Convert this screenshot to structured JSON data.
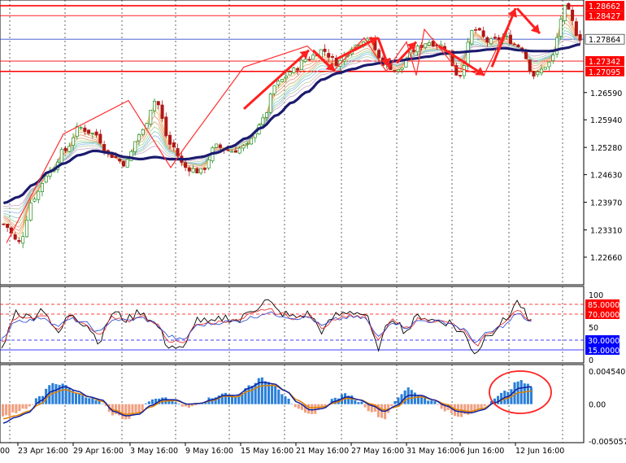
{
  "chart_data": [
    {
      "type": "candlestick",
      "title": "",
      "price_scale": {
        "ylim": [
          1.22,
          1.288
        ],
        "ticks": [
          "1.22660",
          "1.23310",
          "1.23970",
          "1.24630",
          "1.25280",
          "1.25940",
          "1.26590"
        ],
        "highlighted_levels": [
          {
            "label": "1.28662",
            "value": 1.28662,
            "color": "#ff0000"
          },
          {
            "label": "1.28427",
            "value": 1.28427,
            "color": "#ff0000"
          },
          {
            "label": "1.27864",
            "value": 1.27864,
            "color": "#3050c8",
            "current_price": true
          },
          {
            "label": "1.27342",
            "value": 1.27342,
            "color": "#ff0000"
          },
          {
            "label": "1.27095",
            "value": 1.27095,
            "color": "#ff0000"
          }
        ]
      },
      "x_axis_labels": [
        "23 Apr 16:00",
        "29 Apr 16:00",
        "3 May 16:00",
        "9 May 16:00",
        "15 May 16:00",
        "21 May 16:00",
        "27 May 16:00",
        "31 May 16:00",
        "6 Jun 16:00",
        "12 Jun 16:00"
      ],
      "series": [
        {
          "name": "",
          "kind": "price",
          "values": [
            1.2345,
            1.23,
            1.241,
            1.247,
            1.252,
            1.2575,
            1.256,
            1.251,
            1.249,
            1.256,
            1.264,
            1.2535,
            1.248,
            1.247,
            1.253,
            1.252,
            1.253,
            1.259,
            1.268,
            1.271,
            1.274,
            1.276,
            1.273,
            1.277,
            1.279,
            1.273,
            1.271,
            1.276,
            1.278,
            1.277,
            1.27,
            1.281,
            1.278,
            1.279,
            1.277,
            1.27,
            1.273,
            1.286,
            1.279
          ]
        },
        {
          "name": "",
          "kind": "slow-ma",
          "color": "#1b1b6e",
          "values": [
            1.2395,
            1.241,
            1.244,
            1.247,
            1.249,
            1.251,
            1.252,
            1.2515,
            1.2505,
            1.25,
            1.2505,
            1.25,
            1.25,
            1.2505,
            1.2515,
            1.253,
            1.255,
            1.2575,
            1.2605,
            1.2635,
            1.266,
            1.269,
            1.2705,
            1.2715,
            1.2725,
            1.273,
            1.2735,
            1.274,
            1.2745,
            1.2752,
            1.2755,
            1.2758,
            1.2762,
            1.2765,
            1.276,
            1.2758,
            1.2758,
            1.2765,
            1.2774
          ]
        }
      ],
      "pattern_lines": {
        "color": "#ff3030",
        "zigzag": [
          1.23,
          1.256,
          1.264,
          1.248,
          1.253,
          1.272,
          1.277,
          1.271,
          1.279,
          1.271,
          1.278,
          1.27,
          1.281,
          1.272,
          1.27,
          1.286
        ],
        "arrows": [
          {
            "from": 1.262,
            "to": 1.276
          },
          {
            "from": 1.276,
            "to": 1.271
          },
          {
            "from": 1.274,
            "to": 1.279
          },
          {
            "from": 1.279,
            "to": 1.272
          },
          {
            "from": 1.273,
            "to": 1.278
          },
          {
            "from": 1.277,
            "to": 1.27
          },
          {
            "from": 1.272,
            "to": 1.286
          },
          {
            "from": 1.286,
            "to": 1.28
          }
        ]
      }
    },
    {
      "type": "line",
      "title": "",
      "ylim": [
        0,
        100
      ],
      "y_ticks": [
        "100",
        "50",
        "0"
      ],
      "levels": [
        {
          "label": "85.0000",
          "value": 85,
          "color": "#ff0000"
        },
        {
          "label": "70.0000",
          "value": 70,
          "color": "#ff0000"
        },
        {
          "label": "30.0000",
          "value": 30,
          "color": "#0000ff"
        },
        {
          "label": "15.0000",
          "value": 15,
          "color": "#0000ff"
        }
      ],
      "series": [
        {
          "name": "",
          "color": "#000000",
          "values": [
            18,
            73,
            65,
            78,
            40,
            72,
            55,
            30,
            72,
            62,
            75,
            55,
            22,
            15,
            62,
            55,
            65,
            60,
            78,
            90,
            72,
            65,
            70,
            45,
            68,
            75,
            70,
            20,
            65,
            45,
            68,
            60,
            58,
            42,
            12,
            42,
            58,
            88,
            55
          ]
        },
        {
          "name": "",
          "color": "#e02020",
          "values": [
            25,
            65,
            62,
            70,
            48,
            65,
            55,
            38,
            65,
            60,
            68,
            55,
            30,
            24,
            56,
            55,
            60,
            60,
            70,
            78,
            70,
            64,
            67,
            50,
            64,
            68,
            66,
            30,
            60,
            48,
            63,
            60,
            57,
            46,
            22,
            42,
            55,
            78,
            58
          ]
        },
        {
          "name": "",
          "color": "#2040d0",
          "values": [
            30,
            60,
            60,
            65,
            52,
            62,
            56,
            42,
            62,
            60,
            64,
            56,
            36,
            30,
            52,
            55,
            58,
            59,
            65,
            72,
            68,
            64,
            65,
            52,
            62,
            65,
            64,
            36,
            58,
            50,
            60,
            59,
            57,
            48,
            28,
            42,
            52,
            70,
            58
          ]
        }
      ]
    },
    {
      "type": "bar",
      "title": "",
      "ylim": [
        -0.0050573,
        0.0045408
      ],
      "y_ticks": [
        "0.0045408",
        "0.00",
        "-0.0050573"
      ],
      "series": [
        {
          "name": "",
          "kind": "histogram",
          "values": [
            -0.0018,
            -0.0012,
            -0.0005,
            0.001,
            0.003,
            0.0026,
            0.0015,
            0.0008,
            0.0002,
            -0.0014,
            -0.002,
            -0.0012,
            0.0005,
            0.001,
            0.0004,
            -0.0005,
            0.0002,
            0.0008,
            0.0016,
            0.001,
            0.0025,
            0.0035,
            0.0028,
            0.0012,
            -0.0008,
            -0.0015,
            -0.0006,
            0.0008,
            0.0014,
            0.0004,
            -0.001,
            -0.002,
            0.0006,
            0.0022,
            0.0012,
            0.0004,
            -0.0008,
            -0.0018,
            -0.0014,
            -0.0004,
            0.0008,
            0.0018,
            0.0032,
            0.0025
          ]
        },
        {
          "name": "",
          "kind": "signal",
          "color": "#e08000",
          "values": [
            -0.002,
            -0.0016,
            -0.001,
            0.0,
            0.0015,
            0.002,
            0.0015,
            0.001,
            0.0004,
            -0.0008,
            -0.0014,
            -0.0012,
            -0.0004,
            0.0004,
            0.0005,
            0.0,
            0.0001,
            0.0005,
            0.0011,
            0.001,
            0.0018,
            0.0025,
            0.0026,
            0.0018,
            0.0005,
            -0.0005,
            -0.0004,
            0.0002,
            0.0008,
            0.0006,
            0.0,
            -0.0008,
            -0.0004,
            0.0008,
            0.001,
            0.0006,
            0.0,
            -0.0008,
            -0.001,
            -0.0006,
            0.0002,
            0.0008,
            0.0016,
            0.0018
          ]
        },
        {
          "name": "",
          "kind": "macd",
          "color": "#1020a0",
          "values": [
            -0.0026,
            -0.0018,
            -0.0012,
            0.0004,
            0.0018,
            0.0024,
            0.0018,
            0.001,
            0.0006,
            -0.001,
            -0.0016,
            -0.0014,
            -0.0002,
            0.0006,
            0.0006,
            0.0,
            0.0001,
            0.0006,
            0.0012,
            0.0012,
            0.0022,
            0.003,
            0.0028,
            0.0018,
            0.0002,
            -0.0008,
            -0.0006,
            0.0004,
            0.001,
            0.0006,
            -0.0002,
            -0.001,
            -0.0002,
            0.0012,
            0.0012,
            0.0006,
            -0.0002,
            -0.001,
            -0.0012,
            -0.0008,
            0.0002,
            0.001,
            0.0022,
            0.0024
          ]
        }
      ],
      "annotation": {
        "shape": "ellipse",
        "color": "#ff2020"
      }
    }
  ],
  "colors": {
    "background": "#ffffff",
    "grid": "#000000",
    "bull_candle": "#1e8c1e",
    "bear_candle": "#b01818",
    "hist_positive": "#2a7fd8",
    "hist_negative": "#f0a080"
  }
}
